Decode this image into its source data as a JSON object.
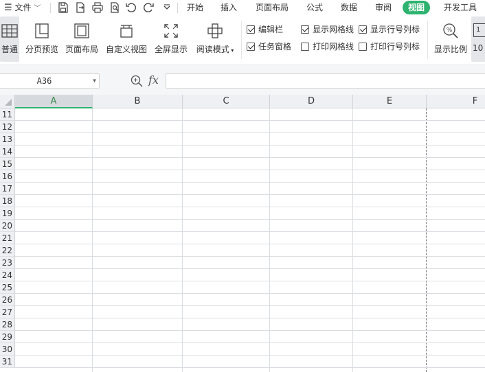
{
  "menubar": {
    "menu_label": "文件",
    "tabs": [
      "开始",
      "插入",
      "页面布局",
      "公式",
      "数据",
      "审阅",
      "视图",
      "开发工具"
    ],
    "active_tab": "视图",
    "accent_color": "#2db36f"
  },
  "ribbon": {
    "buttons": [
      "普通",
      "分页预览",
      "页面布局",
      "自定义视图",
      "全屏显示",
      "阅读模式"
    ],
    "checkboxes": [
      {
        "label": "编辑栏",
        "checked": true
      },
      {
        "label": "任务窗格",
        "checked": true
      },
      {
        "label": "显示网格线",
        "checked": true
      },
      {
        "label": "打印网格线",
        "checked": false
      },
      {
        "label": "显示行号列标",
        "checked": true
      },
      {
        "label": "打印行号列标",
        "checked": false
      }
    ],
    "zoom_label": "显示比例",
    "zoom_partial": "10"
  },
  "formula_bar": {
    "cell_reference": "A36",
    "fx_label": "fx",
    "formula": ""
  },
  "sheet": {
    "columns": [
      "A",
      "B",
      "C",
      "D",
      "E",
      "F"
    ],
    "selected_column": "A",
    "rows": [
      "11",
      "12",
      "13",
      "14",
      "15",
      "16",
      "17",
      "18",
      "19",
      "20",
      "21",
      "22",
      "23",
      "24",
      "25",
      "26",
      "27",
      "28",
      "29",
      "30",
      "31"
    ]
  }
}
